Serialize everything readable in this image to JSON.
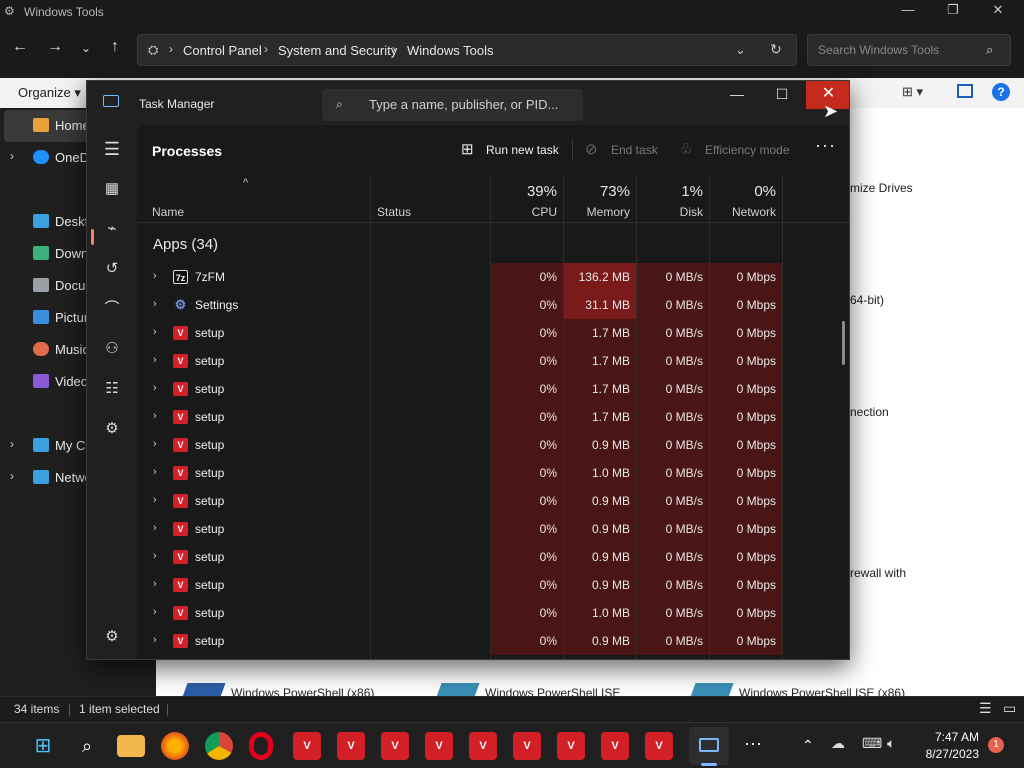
{
  "explorer": {
    "window_title": "Windows Tools",
    "breadcrumb": [
      "Control Panel",
      "System and Security",
      "Windows Tools"
    ],
    "search_placeholder": "Search Windows Tools",
    "organize_label": "Organize",
    "sidebar": [
      {
        "label": "Home",
        "icon": "home-icon",
        "color": "#e9a23b"
      },
      {
        "label": "OneD",
        "icon": "onedrive-icon",
        "color": "#1e90ff"
      },
      {
        "label": "Deskt",
        "icon": "desktop-icon",
        "color": "#3aa0e0"
      },
      {
        "label": "Down",
        "icon": "download-icon",
        "color": "#3ab07a"
      },
      {
        "label": "Docu",
        "icon": "document-icon",
        "color": "#9aa0a6"
      },
      {
        "label": "Pictur",
        "icon": "pictures-icon",
        "color": "#3a8ee0"
      },
      {
        "label": "Music",
        "icon": "music-icon",
        "color": "#e06a4a"
      },
      {
        "label": "Video",
        "icon": "video-icon",
        "color": "#8a5ad8"
      },
      {
        "label": "My Co",
        "icon": "computer-icon",
        "color": "#3aa0e0"
      },
      {
        "label": "Netwo",
        "icon": "network-icon",
        "color": "#3aa0e0"
      }
    ],
    "partial_items": [
      "mize Drives",
      "64-bit)",
      "nection",
      "rewall with"
    ],
    "bottom_items": [
      "Windows PowerShell (x86)",
      "Windows PowerShell ISE",
      "Windows PowerShell ISE (x86)"
    ],
    "status": {
      "items": "34 items",
      "selected": "1 item selected"
    }
  },
  "task_manager": {
    "title": "Task Manager",
    "search_placeholder": "Type a name, publisher, or PID...",
    "page_title": "Processes",
    "toolbar": {
      "run_new_task": "Run new task",
      "end_task": "End task",
      "efficiency_mode": "Efficiency mode"
    },
    "columns": {
      "name": "Name",
      "status": "Status",
      "cpu": {
        "pct": "39%",
        "label": "CPU"
      },
      "memory": {
        "pct": "73%",
        "label": "Memory"
      },
      "disk": {
        "pct": "1%",
        "label": "Disk"
      },
      "network": {
        "pct": "0%",
        "label": "Network"
      }
    },
    "group_label": "Apps (34)",
    "rows": [
      {
        "name": "7zFM",
        "icon": "7zip-icon",
        "cpu": "0%",
        "memory": "136.2 MB",
        "disk": "0 MB/s",
        "network": "0 Mbps"
      },
      {
        "name": "Settings",
        "icon": "settings-gear-icon",
        "cpu": "0%",
        "memory": "31.1 MB",
        "disk": "0 MB/s",
        "network": "0 Mbps"
      },
      {
        "name": "setup",
        "icon": "setup-app-icon",
        "cpu": "0%",
        "memory": "1.7 MB",
        "disk": "0 MB/s",
        "network": "0 Mbps"
      },
      {
        "name": "setup",
        "icon": "setup-app-icon",
        "cpu": "0%",
        "memory": "1.7 MB",
        "disk": "0 MB/s",
        "network": "0 Mbps"
      },
      {
        "name": "setup",
        "icon": "setup-app-icon",
        "cpu": "0%",
        "memory": "1.7 MB",
        "disk": "0 MB/s",
        "network": "0 Mbps"
      },
      {
        "name": "setup",
        "icon": "setup-app-icon",
        "cpu": "0%",
        "memory": "1.7 MB",
        "disk": "0 MB/s",
        "network": "0 Mbps"
      },
      {
        "name": "setup",
        "icon": "setup-app-icon",
        "cpu": "0%",
        "memory": "0.9 MB",
        "disk": "0 MB/s",
        "network": "0 Mbps"
      },
      {
        "name": "setup",
        "icon": "setup-app-icon",
        "cpu": "0%",
        "memory": "1.0 MB",
        "disk": "0 MB/s",
        "network": "0 Mbps"
      },
      {
        "name": "setup",
        "icon": "setup-app-icon",
        "cpu": "0%",
        "memory": "0.9 MB",
        "disk": "0 MB/s",
        "network": "0 Mbps"
      },
      {
        "name": "setup",
        "icon": "setup-app-icon",
        "cpu": "0%",
        "memory": "0.9 MB",
        "disk": "0 MB/s",
        "network": "0 Mbps"
      },
      {
        "name": "setup",
        "icon": "setup-app-icon",
        "cpu": "0%",
        "memory": "0.9 MB",
        "disk": "0 MB/s",
        "network": "0 Mbps"
      },
      {
        "name": "setup",
        "icon": "setup-app-icon",
        "cpu": "0%",
        "memory": "0.9 MB",
        "disk": "0 MB/s",
        "network": "0 Mbps"
      },
      {
        "name": "setup",
        "icon": "setup-app-icon",
        "cpu": "0%",
        "memory": "1.0 MB",
        "disk": "0 MB/s",
        "network": "0 Mbps"
      },
      {
        "name": "setup",
        "icon": "setup-app-icon",
        "cpu": "0%",
        "memory": "0.9 MB",
        "disk": "0 MB/s",
        "network": "0 Mbps"
      }
    ],
    "colors": {
      "heat_low": "#4a1515",
      "heat_high": "#7a1a1a",
      "close_hover": "#c42b1c",
      "rail_indicator": "#ff7a6b"
    }
  },
  "taskbar": {
    "icons": [
      "start-icon",
      "search-icon",
      "file-explorer-icon",
      "firefox-icon",
      "chrome-icon",
      "opera-icon",
      "setup-app-icon",
      "setup-app-icon",
      "setup-app-icon",
      "setup-app-icon",
      "setup-app-icon",
      "setup-app-icon",
      "setup-app-icon",
      "setup-app-icon",
      "task-manager-icon",
      "more-icon"
    ],
    "time": "7:47 AM",
    "date": "8/27/2023",
    "notification_count": "1"
  }
}
